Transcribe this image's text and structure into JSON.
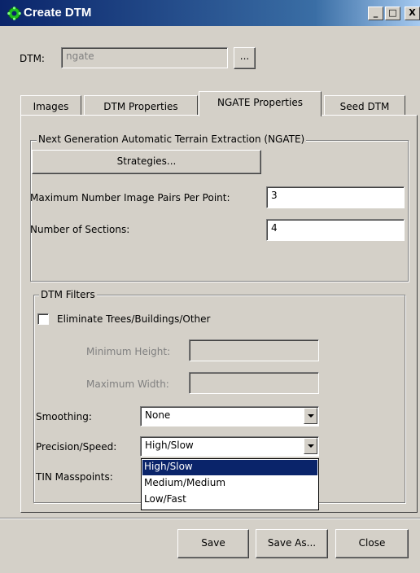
{
  "window": {
    "title": "Create DTM",
    "controls": {
      "minimize": "_",
      "maximize": "□",
      "close": "X"
    }
  },
  "dtm": {
    "label": "DTM:",
    "value": "ngate",
    "browse_label": "..."
  },
  "tabs": [
    {
      "label": "Images"
    },
    {
      "label": "DTM Properties"
    },
    {
      "label": "NGATE Properties"
    },
    {
      "label": "Seed DTM"
    }
  ],
  "active_tab": "NGATE Properties",
  "ngate": {
    "legend": "Next Generation Automatic Terrain Extraction (NGATE)",
    "strategies_label": "Strategies...",
    "max_pairs_label": "Maximum Number Image Pairs Per Point:",
    "max_pairs_value": "3",
    "sections_label": "Number of Sections:",
    "sections_value": "4"
  },
  "filters": {
    "legend": "DTM Filters",
    "eliminate_label": "Eliminate Trees/Buildings/Other",
    "eliminate_checked": false,
    "min_height_label": "Minimum Height:",
    "min_height_value": "",
    "max_width_label": "Maximum Width:",
    "max_width_value": "",
    "smoothing_label": "Smoothing:",
    "smoothing_value": "None",
    "precision_label": "Precision/Speed:",
    "precision_value": "High/Slow",
    "precision_options": [
      "High/Slow",
      "Medium/Medium",
      "Low/Fast"
    ],
    "tin_label": "TIN Masspoints:"
  },
  "buttons": {
    "save": "Save",
    "save_as": "Save As...",
    "close": "Close"
  },
  "colors": {
    "titlebar": "#0a246a",
    "face": "#d4d0c8",
    "selection": "#0a246a",
    "icon": "#1fbf1f"
  }
}
